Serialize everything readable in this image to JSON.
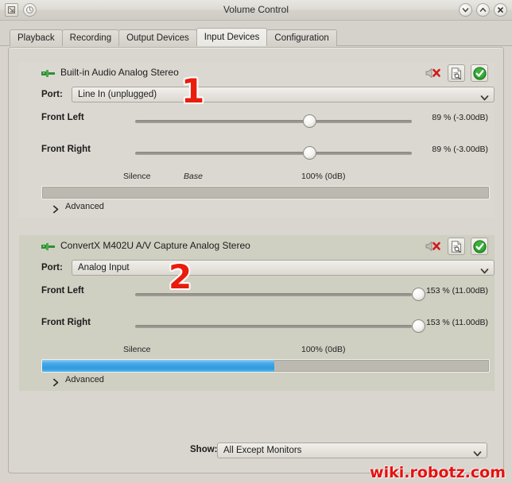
{
  "window": {
    "title": "Volume Control",
    "controls": {
      "menu_icon": "window-menu-icon",
      "shade_icon": "window-shade-icon",
      "minimize_icon": "chevron-down-icon",
      "maximize_icon": "chevron-up-icon",
      "close_icon": "close-x-icon"
    }
  },
  "tabs": [
    {
      "label": "Playback",
      "active": false
    },
    {
      "label": "Recording",
      "active": false
    },
    {
      "label": "Output Devices",
      "active": false
    },
    {
      "label": "Input Devices",
      "active": true
    },
    {
      "label": "Configuration",
      "active": false
    }
  ],
  "devices": [
    {
      "name": "Built-in Audio Analog Stereo",
      "icon": "audio-card-icon",
      "mute_icon": "speaker-muted-icon",
      "properties_icon": "document-properties-icon",
      "default_icon": "green-check-icon",
      "port_label": "Port:",
      "port_value": "Line In (unplugged)",
      "channels": [
        {
          "label": "Front Left",
          "value": "89 % (-3.00dB)",
          "percent": 62
        },
        {
          "label": "Front Right",
          "value": "89 % (-3.00dB)",
          "percent": 62
        }
      ],
      "scale": [
        {
          "text": "Silence",
          "pos": 131
        },
        {
          "text": "Base",
          "pos": 207,
          "italic": true
        },
        {
          "text": "100% (0dB)",
          "pos": 355
        }
      ],
      "meter_percent": 0,
      "advanced_label": "Advanced",
      "annotation": "1"
    },
    {
      "name": "ConvertX M402U A/V Capture Analog Stereo",
      "icon": "audio-card-icon",
      "mute_icon": "speaker-muted-icon",
      "properties_icon": "document-properties-icon",
      "default_icon": "green-check-icon",
      "port_label": "Port:",
      "port_value": "Analog Input",
      "channels": [
        {
          "label": "Front Left",
          "value": "153 % (11.00dB)",
          "percent": 100
        },
        {
          "label": "Front Right",
          "value": "153 % (11.00dB)",
          "percent": 100
        }
      ],
      "scale": [
        {
          "text": "Silence",
          "pos": 131
        },
        {
          "text": "100% (0dB)",
          "pos": 355
        }
      ],
      "meter_percent": 52,
      "advanced_label": "Advanced",
      "annotation": "2"
    }
  ],
  "footer": {
    "show_label": "Show:",
    "show_value": "All Except Monitors"
  },
  "watermark": "wiki.robotz.com",
  "colors": {
    "accent_blue": "#2e9ade",
    "annotation_red": "#e81d0d",
    "device_green": "#2f8f33",
    "mute_red": "#d02020",
    "panel_1": "#dbd8d1",
    "panel_2": "#cfcfc2"
  }
}
